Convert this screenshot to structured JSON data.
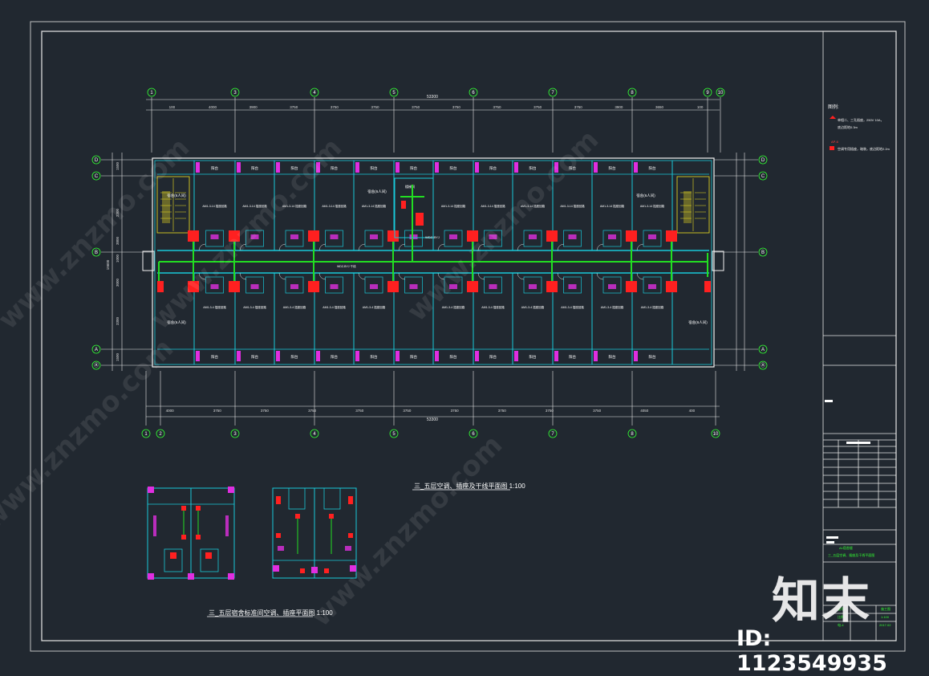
{
  "drawing": {
    "main_title": "三_五层空调、插座及干线平面图 1:100",
    "sub_title": "三_五层宿舍标准间空调、插座平面图 1:100",
    "total_dimension_top": "53300",
    "total_dimension_bottom": "53300",
    "top_dimensions": [
      "100",
      "4000",
      "3900",
      "3750",
      "3750",
      "3750",
      "3750",
      "3750",
      "3750",
      "3750",
      "3750",
      "3900",
      "3650",
      "100"
    ],
    "bottom_dimensions": [
      "4000",
      "3750",
      "3750",
      "3750",
      "3750",
      "3750",
      "3750",
      "3750",
      "3750",
      "3750",
      "4050",
      "400"
    ],
    "grid_columns_top": [
      "1",
      "3",
      "4",
      "5",
      "6",
      "7",
      "8",
      "9",
      "10"
    ],
    "grid_columns_bottom": [
      "1",
      "2",
      "3",
      "4",
      "5",
      "6",
      "7",
      "8",
      "10"
    ],
    "grid_rows": [
      "D",
      "C",
      "B",
      "A",
      "Ⓐ"
    ],
    "left_dimensions": [
      "1500",
      "2300",
      "3800",
      "1000",
      "3000",
      "3300",
      "1500",
      "19600"
    ],
    "room_label": "宿舍(6人间)",
    "balcony_label": "阳台",
    "circuit_label_top": "AM1-3-14 插座回路",
    "circuit_label_bottom": "AM1-3-4 插座回路",
    "corridor_label": "WDZ-BYJ 干线",
    "stair_label": "楼梯间"
  },
  "legend": {
    "header": "图例:",
    "item1": "单相二、三孔插座，250V 10A，",
    "item1b": "底边距地0.3m",
    "item2_code": "AP-6",
    "item2": "空调专用插座，暗装，底边距地2.2m"
  },
  "title_block": {
    "company": "",
    "project": "A1宿舍楼",
    "drawing_name": "三_五层空调、插座及干线平面图",
    "stage": "施工图",
    "scale": "1:100",
    "sheet_no": "电-4",
    "date": "2017.02",
    "label_no": "图号",
    "label_scale": "比例",
    "label_date": "日期"
  },
  "watermark": {
    "logo": "知末",
    "id": "ID: 1123549935",
    "diag_text": "www.znzmo.com"
  },
  "colors": {
    "background": "#212830",
    "frame": "#d9d9d9",
    "wall": "#ffffff",
    "cyan": "#19c7d8",
    "magenta": "#e02ee0",
    "green": "#22dd22",
    "red": "#ff2020",
    "yellow": "#f0e020"
  }
}
